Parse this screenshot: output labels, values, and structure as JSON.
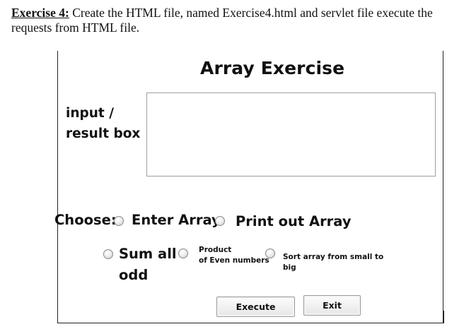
{
  "document": {
    "exercise_lead": "Exercise 4:",
    "instruction": "Create the HTML file, named Exercise4.html and servlet file execute the requests from HTML file."
  },
  "app": {
    "title": "Array Exercise",
    "result_label_line1": "input /",
    "result_label_line2": "result box",
    "result_value": "",
    "choose_label": "Choose:",
    "options": {
      "enter_array": "Enter Array",
      "print_array": "Print out Array",
      "sum_odd_line1": "Sum all",
      "sum_odd_line2": "odd",
      "product_even_line1": "Product",
      "product_even_line2": "of Even numbers",
      "sort_line1": "Sort array from small to",
      "sort_line2": "big"
    },
    "buttons": {
      "execute": "Execute",
      "exit": "Exit"
    }
  }
}
